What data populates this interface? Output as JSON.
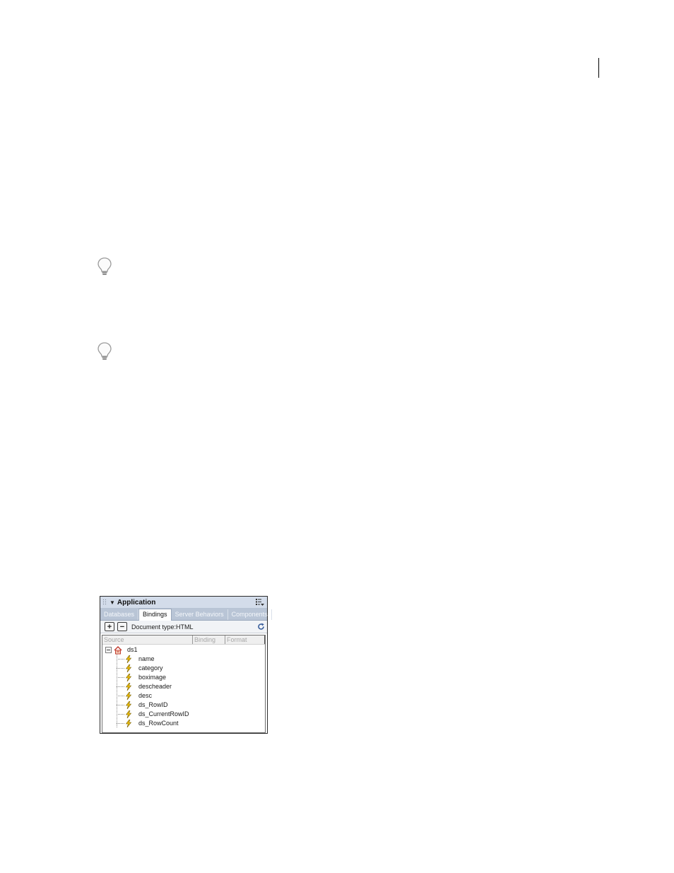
{
  "panel": {
    "title": "Application",
    "tabs": [
      {
        "label": "Databases",
        "active": false
      },
      {
        "label": "Bindings",
        "active": true
      },
      {
        "label": "Server Behaviors",
        "active": false
      },
      {
        "label": "Components",
        "active": false
      }
    ],
    "toolbar": {
      "add": "+",
      "remove": "−",
      "document_type": "Document type:HTML"
    },
    "columns": [
      "Source",
      "Binding",
      "Format"
    ],
    "tree": {
      "root": "ds1",
      "children": [
        "name",
        "category",
        "boximage",
        "descheader",
        "desc",
        "ds_RowID",
        "ds_CurrentRowID",
        "ds_RowCount"
      ]
    }
  },
  "icons": {
    "tip": "lightbulb-icon",
    "data_set": "data-set-icon",
    "field": "lightning-bolt-icon",
    "refresh": "refresh-icon",
    "options": "panel-options-icon"
  },
  "colors": {
    "header_bg": "#d3dcea",
    "tab_bar_bg": "#b9c5d6",
    "bolt_yellow": "#f2c10a"
  }
}
